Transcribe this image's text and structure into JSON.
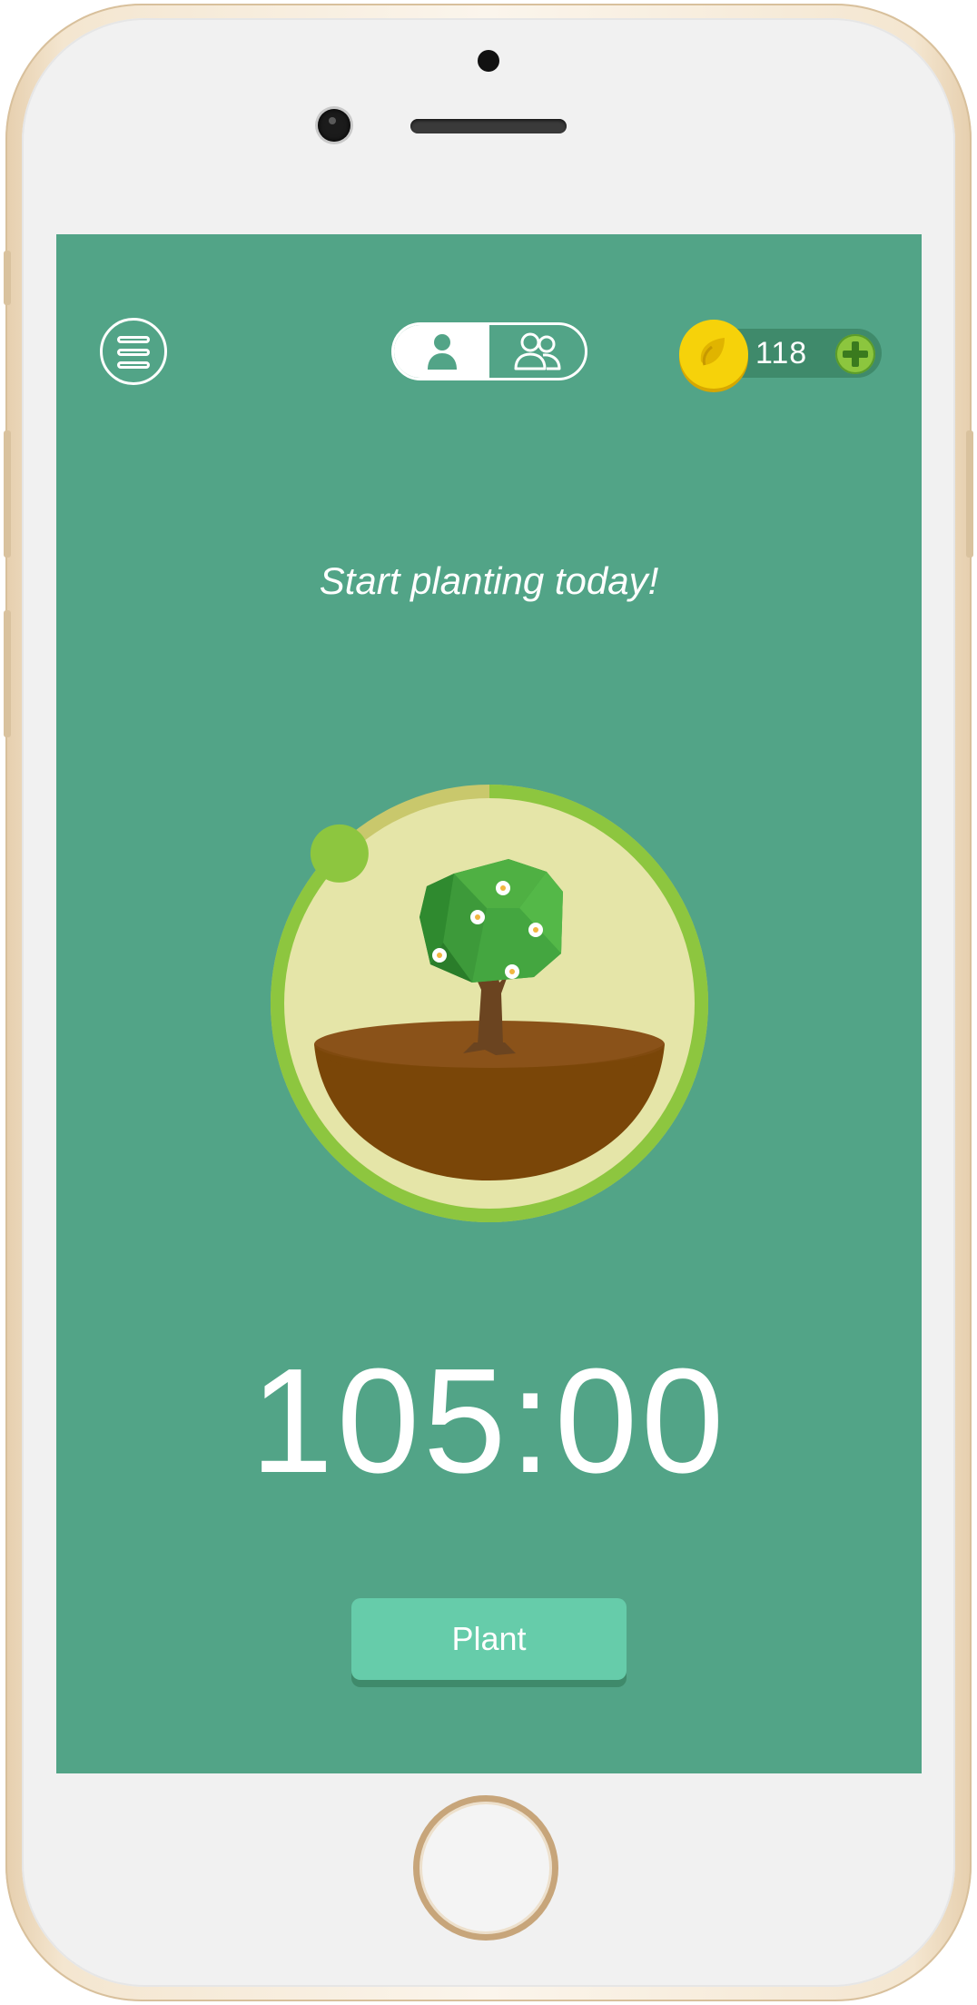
{
  "header": {
    "menu_icon": "hamburger-icon",
    "mode_toggle": {
      "options": [
        {
          "icon": "single-person-icon",
          "active": true
        },
        {
          "icon": "group-people-icon",
          "active": false
        }
      ]
    },
    "coins": {
      "icon": "seed-coin-icon",
      "count": "118",
      "add_icon": "plus-icon"
    }
  },
  "main": {
    "tagline": "Start planting today!",
    "tree_icon": "flowering-tree-icon",
    "timer": "105:00",
    "timer_progress": 0.875,
    "plant_button_label": "Plant"
  },
  "colors": {
    "background": "#52a487",
    "ring_progress": "#8dc63f",
    "ring_remaining": "#c9c86c",
    "ring_inner": "#e5e5a8",
    "button": "#66ccaa",
    "coin": "#f6d20a"
  }
}
